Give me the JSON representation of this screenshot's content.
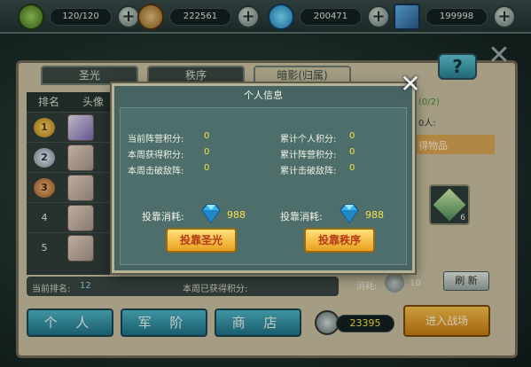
{
  "resources": [
    {
      "icon": "wreath-icon",
      "value": "120/120"
    },
    {
      "icon": "coins-icon",
      "value": "222561"
    },
    {
      "icon": "diamond-icon",
      "value": "200471"
    },
    {
      "icon": "card-icon",
      "value": "199998"
    }
  ],
  "tabs": [
    "圣光",
    "秩序",
    "暗影(归属)"
  ],
  "rank_table": {
    "headers": [
      "排名",
      "头像"
    ],
    "rows": [
      {
        "rank": "1"
      },
      {
        "rank": "2"
      },
      {
        "rank": "3"
      },
      {
        "rank": "4"
      },
      {
        "rank": "5"
      }
    ]
  },
  "bottom_strip": {
    "current_rank_label": "当前排名:",
    "current_rank_value": "12",
    "week_score_label": "本周已获得积分:"
  },
  "right_col": {
    "progress": "(0/2)",
    "people_label": "0人:",
    "reward_label": "得物品",
    "item_count": "6",
    "cost_label": "消耗:",
    "cost_value": "10",
    "refresh": "刷 新"
  },
  "bottom_buttons": [
    "个 人",
    "军 阶",
    "商 店"
  ],
  "score_value": "23395",
  "enter_battle": "进入战场",
  "modal": {
    "title": "个人信息",
    "stats_left": [
      {
        "label": "当前阵营积分:",
        "value": "0"
      },
      {
        "label": "本周获得积分:",
        "value": "0"
      },
      {
        "label": "本周击破敌阵:",
        "value": "0"
      }
    ],
    "stats_right": [
      {
        "label": "累计个人积分:",
        "value": "0"
      },
      {
        "label": "累计阵营积分:",
        "value": "0"
      },
      {
        "label": "累计击破敌阵:",
        "value": "0"
      }
    ],
    "cost_left": {
      "label": "投靠消耗:",
      "value": "988"
    },
    "cost_right": {
      "label": "投靠消耗:",
      "value": "988"
    },
    "btn_left": "投靠圣光",
    "btn_right": "投靠秩序"
  }
}
